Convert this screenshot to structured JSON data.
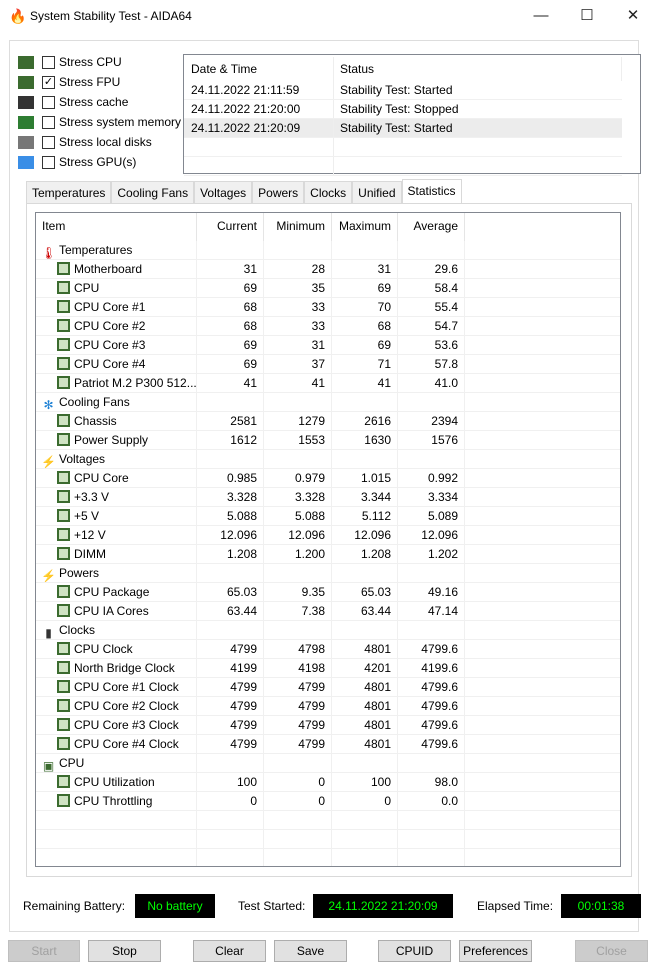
{
  "window": {
    "title": "System Stability Test - AIDA64",
    "minimize": "—",
    "maximize": "☐",
    "close": "✕"
  },
  "stress": [
    {
      "label": "Stress CPU",
      "checked": false,
      "icon": "cpu-icon"
    },
    {
      "label": "Stress FPU",
      "checked": true,
      "icon": "fpu-icon"
    },
    {
      "label": "Stress cache",
      "checked": false,
      "icon": "cache-icon"
    },
    {
      "label": "Stress system memory",
      "checked": false,
      "icon": "memory-icon"
    },
    {
      "label": "Stress local disks",
      "checked": false,
      "icon": "disk-icon"
    },
    {
      "label": "Stress GPU(s)",
      "checked": false,
      "icon": "gpu-icon"
    }
  ],
  "log": {
    "headers": [
      "Date & Time",
      "Status"
    ],
    "rows": [
      [
        "24.11.2022 21:11:59",
        "Stability Test: Started"
      ],
      [
        "24.11.2022 21:20:00",
        "Stability Test: Stopped"
      ],
      [
        "24.11.2022 21:20:09",
        "Stability Test: Started"
      ]
    ]
  },
  "tabs": [
    "Temperatures",
    "Cooling Fans",
    "Voltages",
    "Powers",
    "Clocks",
    "Unified",
    "Statistics"
  ],
  "active_tab": "Statistics",
  "stats": {
    "headers": [
      "Item",
      "Current",
      "Minimum",
      "Maximum",
      "Average"
    ],
    "groups": [
      {
        "name": "Temperatures",
        "icon": "thermometer-icon",
        "items": [
          [
            "Motherboard",
            "31",
            "28",
            "31",
            "29.6"
          ],
          [
            "CPU",
            "69",
            "35",
            "69",
            "58.4"
          ],
          [
            "CPU Core #1",
            "68",
            "33",
            "70",
            "55.4"
          ],
          [
            "CPU Core #2",
            "68",
            "33",
            "68",
            "54.7"
          ],
          [
            "CPU Core #3",
            "69",
            "31",
            "69",
            "53.6"
          ],
          [
            "CPU Core #4",
            "69",
            "37",
            "71",
            "57.8"
          ],
          [
            "Patriot M.2 P300 512...",
            "41",
            "41",
            "41",
            "41.0"
          ]
        ]
      },
      {
        "name": "Cooling Fans",
        "icon": "fan-icon",
        "items": [
          [
            "Chassis",
            "2581",
            "1279",
            "2616",
            "2394"
          ],
          [
            "Power Supply",
            "1612",
            "1553",
            "1630",
            "1576"
          ]
        ]
      },
      {
        "name": "Voltages",
        "icon": "voltage-icon",
        "items": [
          [
            "CPU Core",
            "0.985",
            "0.979",
            "1.015",
            "0.992"
          ],
          [
            "+3.3 V",
            "3.328",
            "3.328",
            "3.344",
            "3.334"
          ],
          [
            "+5 V",
            "5.088",
            "5.088",
            "5.112",
            "5.089"
          ],
          [
            "+12 V",
            "12.096",
            "12.096",
            "12.096",
            "12.096"
          ],
          [
            "DIMM",
            "1.208",
            "1.200",
            "1.208",
            "1.202"
          ]
        ]
      },
      {
        "name": "Powers",
        "icon": "power-icon",
        "items": [
          [
            "CPU Package",
            "65.03",
            "9.35",
            "65.03",
            "49.16"
          ],
          [
            "CPU IA Cores",
            "63.44",
            "7.38",
            "63.44",
            "47.14"
          ]
        ]
      },
      {
        "name": "Clocks",
        "icon": "clock-chip-icon",
        "items": [
          [
            "CPU Clock",
            "4799",
            "4798",
            "4801",
            "4799.6"
          ],
          [
            "North Bridge Clock",
            "4199",
            "4198",
            "4201",
            "4199.6"
          ],
          [
            "CPU Core #1 Clock",
            "4799",
            "4799",
            "4801",
            "4799.6"
          ],
          [
            "CPU Core #2 Clock",
            "4799",
            "4799",
            "4801",
            "4799.6"
          ],
          [
            "CPU Core #3 Clock",
            "4799",
            "4799",
            "4801",
            "4799.6"
          ],
          [
            "CPU Core #4 Clock",
            "4799",
            "4799",
            "4801",
            "4799.6"
          ]
        ]
      },
      {
        "name": "CPU",
        "icon": "cpu-icon",
        "items": [
          [
            "CPU Utilization",
            "100",
            "0",
            "100",
            "98.0"
          ],
          [
            "CPU Throttling",
            "0",
            "0",
            "0",
            "0.0"
          ]
        ]
      }
    ]
  },
  "footer": {
    "battery_label": "Remaining Battery:",
    "battery_value": "No battery",
    "started_label": "Test Started:",
    "started_value": "24.11.2022 21:20:09",
    "elapsed_label": "Elapsed Time:",
    "elapsed_value": "00:01:38"
  },
  "buttons": {
    "start": "Start",
    "stop": "Stop",
    "clear": "Clear",
    "save": "Save",
    "cpuid": "CPUID",
    "preferences": "Preferences",
    "close": "Close"
  }
}
